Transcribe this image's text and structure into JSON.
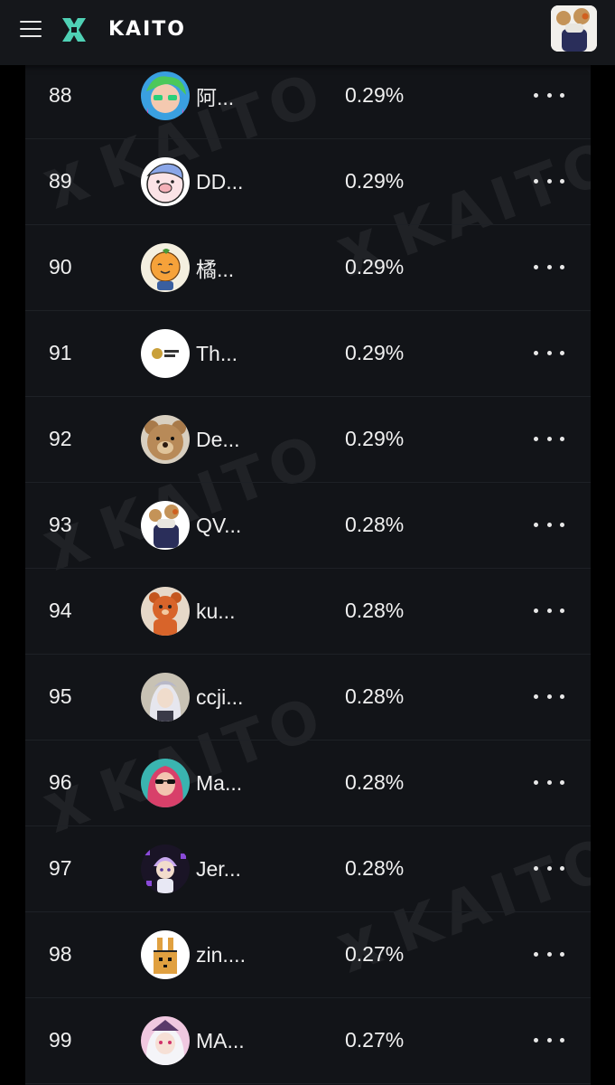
{
  "header": {
    "brand": "KAITO",
    "menu_icon": "hamburger-menu-icon",
    "logo_icon": "kaito-logo-icon",
    "brand_color": "#4fd1b5"
  },
  "watermark_text": "KAITO",
  "rows": [
    {
      "rank": "88",
      "name": "阿...",
      "share": "0.29%",
      "avatar": "green-haired-cartoon-avatar"
    },
    {
      "rank": "89",
      "name": "DD...",
      "share": "0.29%",
      "avatar": "pig-cartoon-avatar"
    },
    {
      "rank": "90",
      "name": "橘...",
      "share": "0.29%",
      "avatar": "orange-character-avatar"
    },
    {
      "rank": "91",
      "name": "Th...",
      "share": "0.29%",
      "avatar": "altcoin-king-logo-avatar"
    },
    {
      "rank": "92",
      "name": "De...",
      "share": "0.29%",
      "avatar": "teddy-bear-avatar"
    },
    {
      "rank": "93",
      "name": "QV...",
      "share": "0.28%",
      "avatar": "bear-figure-avatar"
    },
    {
      "rank": "94",
      "name": "ku...",
      "share": "0.28%",
      "avatar": "orange-bear-avatar"
    },
    {
      "rank": "95",
      "name": "ccji...",
      "share": "0.28%",
      "avatar": "anime-character-avatar"
    },
    {
      "rank": "96",
      "name": "Ma...",
      "share": "0.28%",
      "avatar": "pink-haired-avatar"
    },
    {
      "rank": "97",
      "name": "Jer...",
      "share": "0.28%",
      "avatar": "purple-chibi-avatar"
    },
    {
      "rank": "98",
      "name": "zin....",
      "share": "0.27%",
      "avatar": "pixel-rabbit-avatar"
    },
    {
      "rank": "99",
      "name": "MA...",
      "share": "0.27%",
      "avatar": "anime-girl-avatar"
    }
  ],
  "row_more_icon": "more-dots-icon"
}
